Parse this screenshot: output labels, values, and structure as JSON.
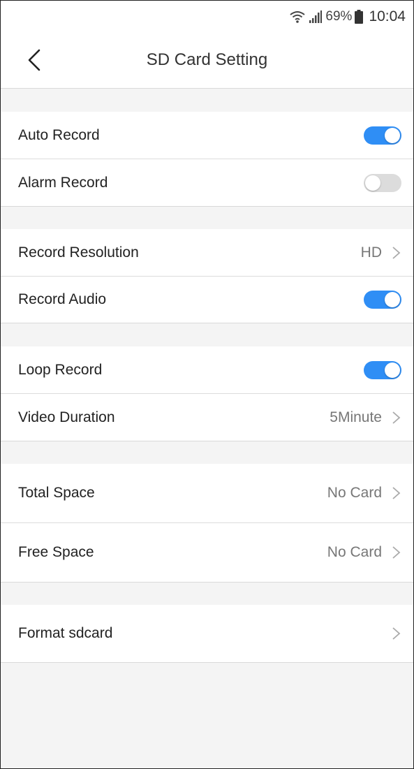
{
  "status_bar": {
    "battery_percent": "69%",
    "time": "10:04",
    "icons": [
      "wifi-icon",
      "signal-icon",
      "battery-icon"
    ]
  },
  "header": {
    "title": "SD Card Setting",
    "back_icon": "back-arrow-icon"
  },
  "colors": {
    "accent": "#2f8ef5",
    "toggle_off": "#dcdcdc",
    "background": "#f4f4f4"
  },
  "groups": [
    {
      "rows": [
        {
          "label": "Auto Record",
          "type": "toggle",
          "checked": true
        },
        {
          "label": "Alarm Record",
          "type": "toggle",
          "checked": false
        }
      ]
    },
    {
      "rows": [
        {
          "label": "Record Resolution",
          "type": "link",
          "value": "HD"
        },
        {
          "label": "Record Audio",
          "type": "toggle",
          "checked": true
        }
      ]
    },
    {
      "rows": [
        {
          "label": "Loop Record",
          "type": "toggle",
          "checked": true
        },
        {
          "label": "Video Duration",
          "type": "link",
          "value": "5Minute"
        }
      ]
    },
    {
      "rows": [
        {
          "label": "Total Space",
          "type": "link",
          "value": "No Card"
        },
        {
          "label": "Free Space",
          "type": "link",
          "value": "No Card"
        }
      ]
    },
    {
      "rows": [
        {
          "label": "Format sdcard",
          "type": "link",
          "value": ""
        }
      ]
    }
  ]
}
